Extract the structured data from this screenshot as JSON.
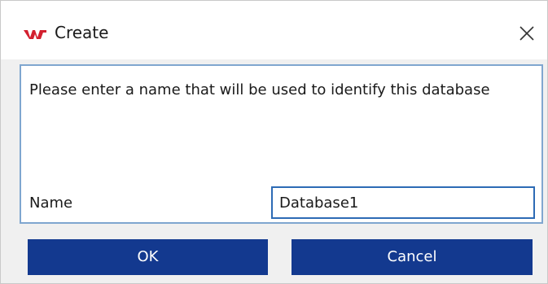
{
  "window": {
    "title": "Create",
    "icon": "app-logo-icon",
    "close_icon": "close-icon"
  },
  "dialog": {
    "message": "Please enter a name that will be used to identify this database",
    "name_label": "Name",
    "name_value": "Database1"
  },
  "buttons": {
    "ok_label": "OK",
    "cancel_label": "Cancel"
  },
  "colors": {
    "accent": "#13398f",
    "panel_border": "#7fa6cf",
    "input_border": "#2d6bb5",
    "logo": "#d3202f"
  }
}
